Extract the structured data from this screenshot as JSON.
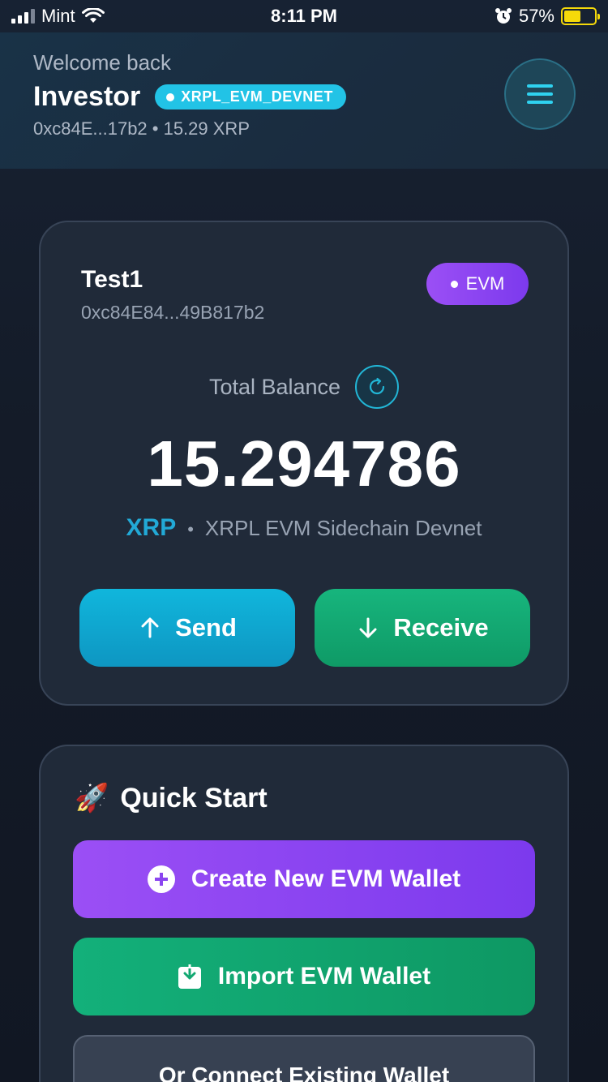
{
  "status_bar": {
    "carrier": "Mint",
    "time": "8:11 PM",
    "battery_percent": "57%",
    "icons": [
      "signal-icon",
      "wifi-icon",
      "alarm-icon",
      "battery-charging-icon"
    ]
  },
  "header": {
    "greeting": "Welcome back",
    "username": "Investor",
    "network_badge": "XRPL_EVM_DEVNET",
    "address_summary": "0xc84E...17b2 • 15.29 XRP",
    "menu_icon": "hamburger-menu-icon"
  },
  "wallet_card": {
    "name": "Test1",
    "address": "0xc84E84...49B817b2",
    "type_badge": "EVM",
    "total_balance_label": "Total Balance",
    "refresh_icon": "refresh-icon",
    "balance": "15.294786",
    "currency": "XRP",
    "separator": "•",
    "network_name": "XRPL EVM Sidechain Devnet",
    "send_label": "Send",
    "receive_label": "Receive"
  },
  "quick_start": {
    "emoji": "🚀",
    "title": "Quick Start",
    "create_label": "Create New EVM Wallet",
    "import_label": "Import EVM Wallet",
    "connect_label": "Or Connect Existing Wallet"
  },
  "colors": {
    "accent_cyan": "#22c3e6",
    "evm_purple": "#8b45f0",
    "receive_green": "#13a872",
    "send_blue": "#0fa8d2"
  }
}
